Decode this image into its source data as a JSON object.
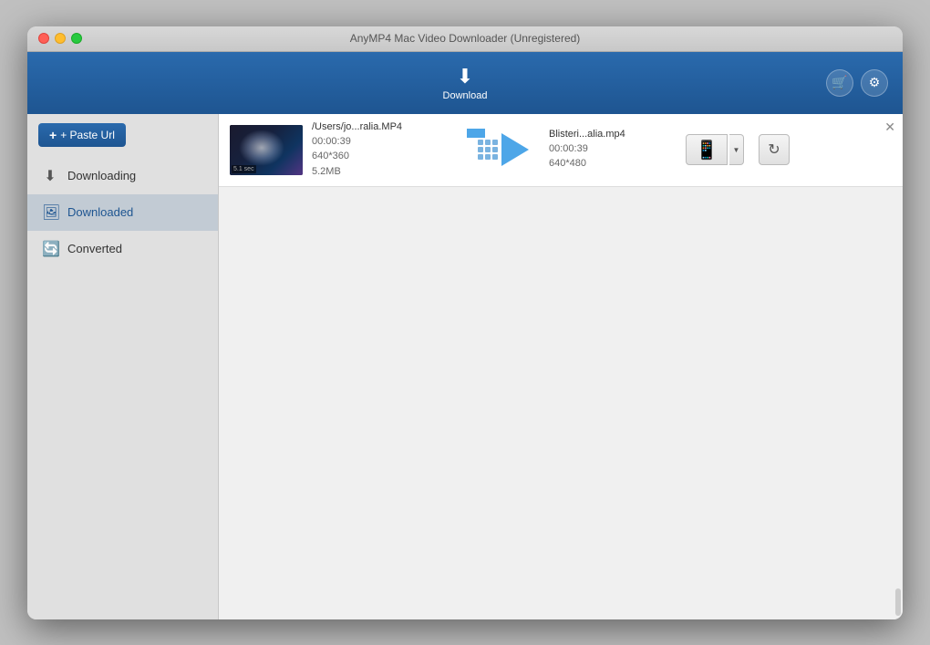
{
  "window": {
    "title": "AnyMP4 Mac Video Downloader (Unregistered)"
  },
  "toolbar": {
    "download_label": "Download",
    "shop_icon": "🛒",
    "settings_icon": "⚙"
  },
  "sidebar": {
    "paste_url_label": "+ Paste Url",
    "items": [
      {
        "id": "downloading",
        "label": "Downloading",
        "icon": "⬇"
      },
      {
        "id": "downloaded",
        "label": "Downloaded",
        "icon": "🖼"
      },
      {
        "id": "converted",
        "label": "Converted",
        "icon": "🔄"
      }
    ],
    "active_item": "downloaded"
  },
  "file_list": [
    {
      "thumbnail_label": "5.1 sec",
      "source_name": "/Users/jo...ralia.MP4",
      "source_duration": "00:00:39",
      "source_resolution": "640*360",
      "source_size": "5.2MB",
      "output_name": "Blisteri...alia.mp4",
      "output_duration": "00:00:39",
      "output_resolution": "640*480"
    }
  ]
}
